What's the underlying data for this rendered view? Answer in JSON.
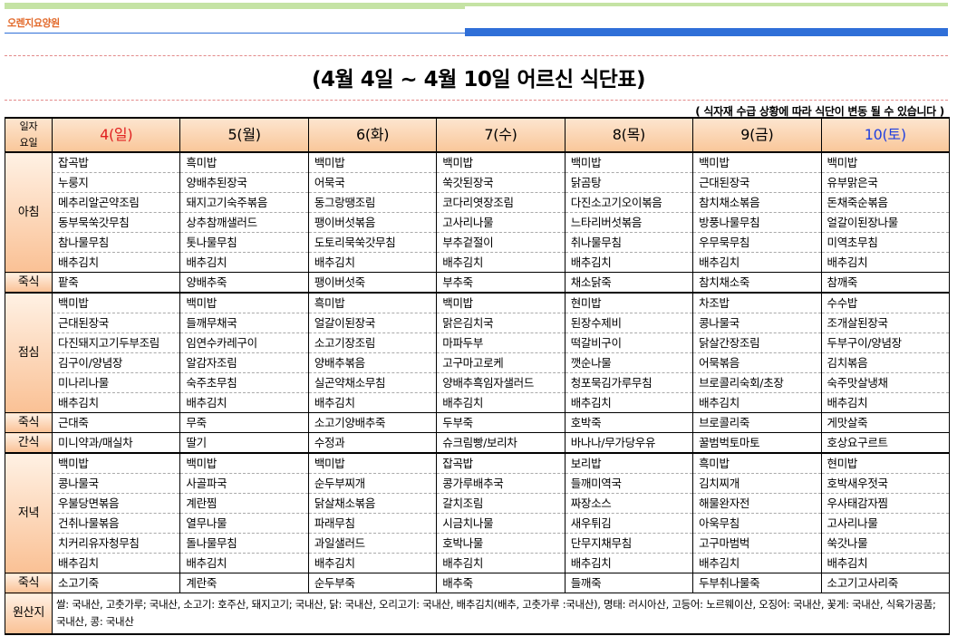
{
  "header": {
    "logo": "오렌지요양원",
    "title": "(4월 4일 ~ 4월 10일 어르신 식단표)",
    "notice": "( 식자재 수급 상황에 따라 식단이 변동 될 수 있습니다 )"
  },
  "table": {
    "corner_top": "일자",
    "corner_bottom": "요일",
    "days": [
      "4(일)",
      "5(월)",
      "6(화)",
      "7(수)",
      "8(목)",
      "9(금)",
      "10(토)"
    ],
    "breakfast": {
      "label": "아침",
      "rows": [
        [
          "잡곡밥",
          "흑미밥",
          "백미밥",
          "백미밥",
          "백미밥",
          "백미밥",
          "백미밥"
        ],
        [
          "누룽지",
          "양배추된장국",
          "어묵국",
          "쑥갓된장국",
          "닭곰탕",
          "근대된장국",
          "유부맑은국"
        ],
        [
          "메추리알곤약조림",
          "돼지고기숙주볶음",
          "동그랑땡조림",
          "코다리엿장조림",
          "다진소고기오이볶음",
          "참치채소볶음",
          "돈채죽순볶음"
        ],
        [
          "동부묵쑥갓무침",
          "상추참깨샐러드",
          "팽이버섯볶음",
          "고사리나물",
          "느타리버섯볶음",
          "방풍나물무침",
          "얼갈이된장나물"
        ],
        [
          "참나물무침",
          "톳나물무침",
          "도토리묵쑥갓무침",
          "부추겉절이",
          "취나물무침",
          "우무묵무침",
          "미역초무침"
        ],
        [
          "배추김치",
          "배추김치",
          "배추김치",
          "배추김치",
          "배추김치",
          "배추김치",
          "배추김치"
        ]
      ],
      "porridge_label": "죽식",
      "porridge": [
        "팥죽",
        "양배추죽",
        "팽이버섯죽",
        "부추죽",
        "채소닭죽",
        "참치채소죽",
        "참깨죽"
      ]
    },
    "lunch": {
      "label": "점심",
      "rows": [
        [
          "백미밥",
          "백미밥",
          "흑미밥",
          "백미밥",
          "현미밥",
          "차조밥",
          "수수밥"
        ],
        [
          "근대된장국",
          "들깨무채국",
          "얼갈이된장국",
          "맑은김치국",
          "된장수제비",
          "콩나물국",
          "조개살된장국"
        ],
        [
          "다진돼지고기두부조림",
          "임연수카레구이",
          "소고기장조림",
          "마파두부",
          "떡갈비구이",
          "닭살간장조림",
          "두부구이/양념장"
        ],
        [
          "김구이/양념장",
          "알감자조림",
          "양배추볶음",
          "고구마고로케",
          "깻순나물",
          "어묵볶음",
          "김치볶음"
        ],
        [
          "미나리나물",
          "숙주초무침",
          "실곤약채소무침",
          "양배추흑임자샐러드",
          "청포묵김가루무침",
          "브로콜리숙회/초장",
          "숙주맛살냉채"
        ],
        [
          "배추김치",
          "배추김치",
          "배추김치",
          "배추김치",
          "배추김치",
          "배추김치",
          "배추김치"
        ]
      ],
      "porridge_label": "죽식",
      "porridge": [
        "근대죽",
        "무죽",
        "소고기양배추죽",
        "두부죽",
        "호박죽",
        "브로콜리죽",
        "게맛살죽"
      ],
      "snack_label": "간식",
      "snack": [
        "미니약과/매실차",
        "딸기",
        "수정과",
        "슈크림빵/보리차",
        "바나나/무가당우유",
        "꿀범벅토마토",
        "호상요구르트"
      ]
    },
    "dinner": {
      "label": "저녁",
      "rows": [
        [
          "백미밥",
          "백미밥",
          "백미밥",
          "잡곡밥",
          "보리밥",
          "흑미밥",
          "현미밥"
        ],
        [
          "콩나물국",
          "사골파국",
          "순두부찌개",
          "콩가루배추국",
          "들깨미역국",
          "김치찌개",
          "호박새우젓국"
        ],
        [
          "우불당면볶음",
          "계란찜",
          "닭살채소볶음",
          "갈치조림",
          "짜장소스",
          "해물완자전",
          "우사태감자찜"
        ],
        [
          "건취나물볶음",
          "열무나물",
          "파래무침",
          "시금치나물",
          "새우튀김",
          "아욱무침",
          "고사리나물"
        ],
        [
          "치커리유자청무침",
          "돌나물무침",
          "과일샐러드",
          "호박나물",
          "단무지채무침",
          "고구마범벅",
          "쑥갓나물"
        ],
        [
          "배추김치",
          "배추김치",
          "배추김치",
          "배추김치",
          "배추김치",
          "배추김치",
          "배추김치"
        ]
      ],
      "porridge_label": "죽식",
      "porridge": [
        "소고기죽",
        "계란죽",
        "순두부죽",
        "배추죽",
        "들깨죽",
        "두부취나물죽",
        "소고기고사리죽"
      ]
    },
    "origin": {
      "label": "원산지",
      "text": "쌀: 국내산, 고춧가루; 국내산, 소고기: 호주산, 돼지고기; 국내산, 닭: 국내산, 오리고기: 국내산, 배추김치(배추, 고춧가루 :국내산), 명태: 러시아산, 고등어: 노르웨이산, 오징어: 국내산, 꽃게: 국내산, 식육가공품; 국내산, 콩: 국내산"
    }
  },
  "colors": {
    "sunday": "#e02020",
    "saturday": "#2040e0",
    "accent_blue": "#2f6fd8",
    "accent_green": "#c5e3a4",
    "header_fill": "#f9c79a"
  }
}
